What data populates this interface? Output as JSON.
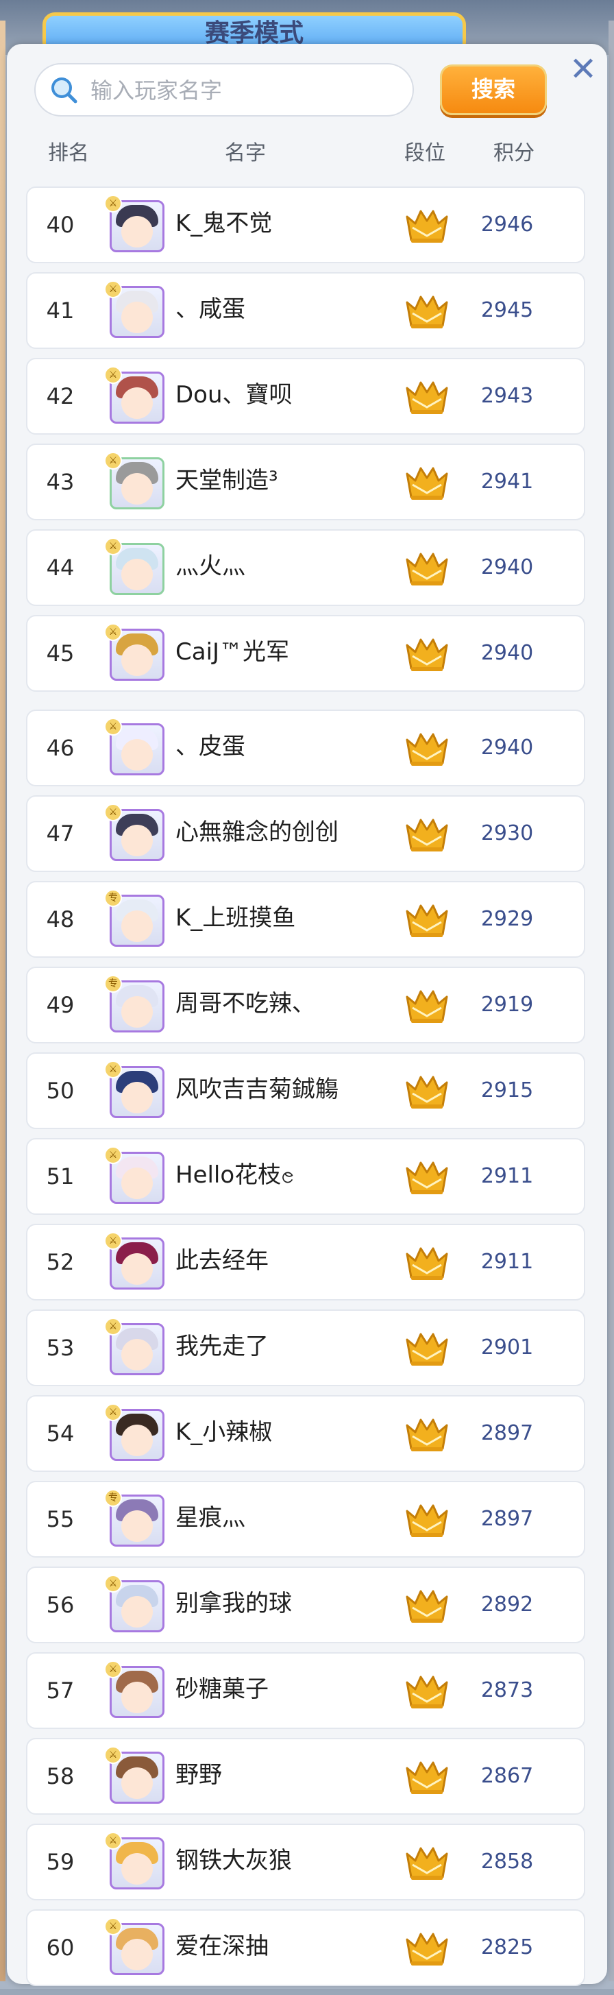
{
  "header": {
    "mode_tab_label": "赛季模式",
    "close_symbol": "✕"
  },
  "search": {
    "placeholder": "输入玩家名字",
    "button_label": "搜索"
  },
  "columns": {
    "rank": "排名",
    "name": "名字",
    "tier": "段位",
    "score": "积分"
  },
  "colors": {
    "accent_orange": "#f68a10",
    "score_blue": "#3a4e8c",
    "tier_gold": "#f2b01e"
  },
  "icons": {
    "search": "magnifier-icon",
    "close": "close-icon",
    "tier": "gold-crown-tier-icon"
  },
  "players": [
    {
      "rank": "40",
      "name": "K_鬼不觉",
      "score": "2946",
      "hair": "#3a3a52",
      "frame": "#a779e0",
      "badge": "⚔"
    },
    {
      "rank": "41",
      "name": "、咸蛋",
      "score": "2945",
      "hair": "#e8e8ee",
      "frame": "#a779e0",
      "badge": "⚔"
    },
    {
      "rank": "42",
      "name": "Dou、寶呗",
      "score": "2943",
      "hair": "#b0524a",
      "frame": "#a779e0",
      "badge": "⚔"
    },
    {
      "rank": "43",
      "name": "天堂制造³",
      "score": "2941",
      "hair": "#9a9a9a",
      "frame": "#8ed1a0",
      "badge": "⚔"
    },
    {
      "rank": "44",
      "name": "灬火灬",
      "score": "2940",
      "hair": "#cfe3f1",
      "frame": "#8ed1a0",
      "badge": "⚔"
    },
    {
      "rank": "45",
      "name": "CaiJ™光军",
      "score": "2940",
      "hair": "#d8a440",
      "frame": "#a779e0",
      "badge": "⚔"
    },
    {
      "rank": "46",
      "name": "、皮蛋",
      "score": "2940",
      "hair": "#eeeeff",
      "frame": "#a779e0",
      "badge": "⚔"
    },
    {
      "rank": "47",
      "name": "心無雜念的创创",
      "score": "2930",
      "hair": "#3e3e58",
      "frame": "#a779e0",
      "badge": "⚔"
    },
    {
      "rank": "48",
      "name": "K_上班摸鱼",
      "score": "2929",
      "hair": "#e6ecf6",
      "frame": "#a779e0",
      "badge": "专"
    },
    {
      "rank": "49",
      "name": "周哥不吃辣、",
      "score": "2919",
      "hair": "#e0e4f4",
      "frame": "#a779e0",
      "badge": "专"
    },
    {
      "rank": "50",
      "name": "风吹吉吉菊鋮觴",
      "score": "2915",
      "hair": "#2c3e7a",
      "frame": "#a779e0",
      "badge": "⚔"
    },
    {
      "rank": "51",
      "name": "Hello花枝ၔ",
      "score": "2911",
      "hair": "#f3e6f2",
      "frame": "#a779e0",
      "badge": "⚔"
    },
    {
      "rank": "52",
      "name": "此去经年",
      "score": "2911",
      "hair": "#8a1e4a",
      "frame": "#a779e0",
      "badge": "⚔"
    },
    {
      "rank": "53",
      "name": "我先走了",
      "score": "2901",
      "hair": "#d8d8ea",
      "frame": "#a779e0",
      "badge": "⚔"
    },
    {
      "rank": "54",
      "name": "K_小辣椒",
      "score": "2897",
      "hair": "#3a2a22",
      "frame": "#a779e0",
      "badge": "⚔"
    },
    {
      "rank": "55",
      "name": "星痕灬",
      "score": "2897",
      "hair": "#8c7ab6",
      "frame": "#a779e0",
      "badge": "专"
    },
    {
      "rank": "56",
      "name": "别拿我的球",
      "score": "2892",
      "hair": "#c8d4ec",
      "frame": "#a779e0",
      "badge": "⚔"
    },
    {
      "rank": "57",
      "name": "砂糖菓子",
      "score": "2873",
      "hair": "#a06a4a",
      "frame": "#a779e0",
      "badge": "⚔"
    },
    {
      "rank": "58",
      "name": "野野",
      "score": "2867",
      "hair": "#8a5a3a",
      "frame": "#a779e0",
      "badge": "⚔"
    },
    {
      "rank": "59",
      "name": "钢铁大灰狼",
      "score": "2858",
      "hair": "#f0b64a",
      "frame": "#a779e0",
      "badge": "⚔"
    },
    {
      "rank": "60",
      "name": "爱在深抽",
      "score": "2825",
      "hair": "#e8b060",
      "frame": "#a779e0",
      "badge": "⚔"
    }
  ]
}
